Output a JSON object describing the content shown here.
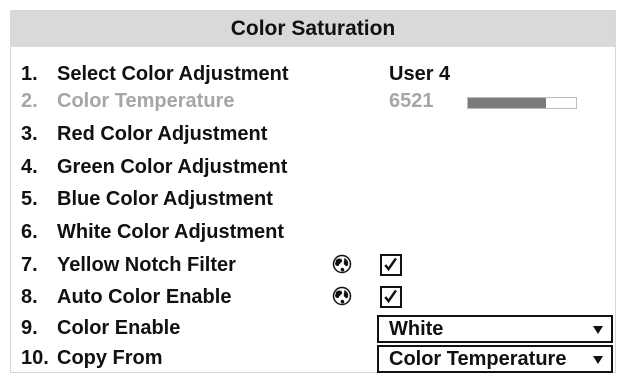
{
  "title": "Color Saturation",
  "items": [
    {
      "num": "1.",
      "label": "Select Color Adjustment",
      "value": "User 4"
    },
    {
      "num": "2.",
      "label": "Color Temperature",
      "value": "6521",
      "slider_fraction": 0.72
    },
    {
      "num": "3.",
      "label": "Red Color Adjustment"
    },
    {
      "num": "4.",
      "label": "Green Color Adjustment"
    },
    {
      "num": "5.",
      "label": "Blue Color Adjustment"
    },
    {
      "num": "6.",
      "label": "White Color Adjustment"
    },
    {
      "num": "7.",
      "label": "Yellow Notch Filter",
      "icon": "globe-icon",
      "checked": true
    },
    {
      "num": "8.",
      "label": "Auto Color Enable",
      "icon": "globe-icon",
      "checked": true
    },
    {
      "num": "9.",
      "label": "Color Enable",
      "selected": "White"
    },
    {
      "num": "10.",
      "label": "Copy From",
      "selected": "Color Temperature"
    }
  ]
}
